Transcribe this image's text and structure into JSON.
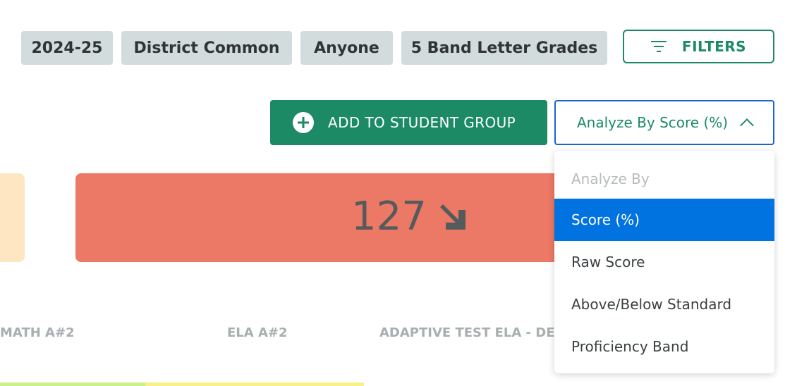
{
  "filter_chips": [
    "2024-25",
    "District Common",
    "Anyone",
    "5 Band Letter Grades"
  ],
  "filters_button": {
    "label": "FILTERS",
    "icon": "filter-lines-icon"
  },
  "add_group_button": {
    "label": "ADD TO STUDENT GROUP",
    "icon": "plus-circle-icon"
  },
  "analyze_select": {
    "value": "Analyze By Score (%)",
    "icon": "chevron-up-icon"
  },
  "card": {
    "value": "127",
    "trend_icon": "arrow-down-right-icon",
    "color": "#ec7965"
  },
  "columns": [
    "MATH A#2",
    "ELA A#2",
    "ADAPTIVE TEST ELA - DEM"
  ],
  "dropdown": {
    "header": "Analyze By",
    "options": [
      "Score (%)",
      "Raw Score",
      "Above/Below Standard",
      "Proficiency Band"
    ],
    "selected": "Score (%)"
  },
  "colors": {
    "accent": "#1b8a65",
    "selected": "#0073e0",
    "chip": "#d3dcdd"
  }
}
